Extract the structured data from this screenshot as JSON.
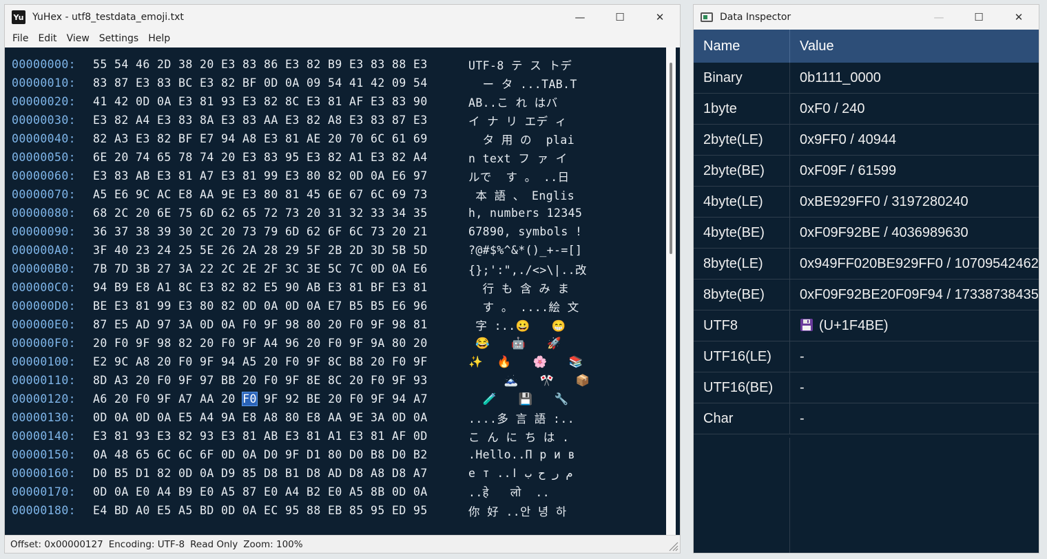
{
  "main_window": {
    "title": "YuHex - utf8_testdata_emoji.txt",
    "app_icon_text": "Yu",
    "caption": {
      "minimize": "—",
      "maximize": "☐",
      "close": "✕"
    }
  },
  "menu": [
    "File",
    "Edit",
    "View",
    "Settings",
    "Help"
  ],
  "hex_rows": [
    {
      "addr": "00000000:",
      "bytes": "55 54 46 2D 38 20 E3 83 86 E3 82 B9 E3 83 88 E3",
      "ascii": "UTF-8 テ ス トデ"
    },
    {
      "addr": "00000010:",
      "bytes": "83 87 E3 83 BC E3 82 BF 0D 0A 09 54 41 42 09 54",
      "ascii": "  ー タ ...TAB.T"
    },
    {
      "addr": "00000020:",
      "bytes": "41 42 0D 0A E3 81 93 E3 82 8C E3 81 AF E3 83 90",
      "ascii": "AB..こ れ はバ"
    },
    {
      "addr": "00000030:",
      "bytes": "E3 82 A4 E3 83 8A E3 83 AA E3 82 A8 E3 83 87 E3",
      "ascii": "イ ナ リ エデ ィ"
    },
    {
      "addr": "00000040:",
      "bytes": "82 A3 E3 82 BF E7 94 A8 E3 81 AE 20 70 6C 61 69",
      "ascii": "  タ 用 の  plai"
    },
    {
      "addr": "00000050:",
      "bytes": "6E 20 74 65 78 74 20 E3 83 95 E3 82 A1 E3 82 A4",
      "ascii": "n text フ ァ イ"
    },
    {
      "addr": "00000060:",
      "bytes": "E3 83 AB E3 81 A7 E3 81 99 E3 80 82 0D 0A E6 97",
      "ascii": "ルで  す 。 ..日"
    },
    {
      "addr": "00000070:",
      "bytes": "A5 E6 9C AC E8 AA 9E E3 80 81 45 6E 67 6C 69 73",
      "ascii": " 本 語 、 Englis"
    },
    {
      "addr": "00000080:",
      "bytes": "68 2C 20 6E 75 6D 62 65 72 73 20 31 32 33 34 35",
      "ascii": "h, numbers 12345"
    },
    {
      "addr": "00000090:",
      "bytes": "36 37 38 39 30 2C 20 73 79 6D 62 6F 6C 73 20 21",
      "ascii": "67890, symbols !"
    },
    {
      "addr": "000000A0:",
      "bytes": "3F 40 23 24 25 5E 26 2A 28 29 5F 2B 2D 3D 5B 5D",
      "ascii": "?@#$%^&*()_+-=[]"
    },
    {
      "addr": "000000B0:",
      "bytes": "7B 7D 3B 27 3A 22 2C 2E 2F 3C 3E 5C 7C 0D 0A E6",
      "ascii": "{};':\",./<>\\|..改"
    },
    {
      "addr": "000000C0:",
      "bytes": "94 B9 E8 A1 8C E3 82 82 E5 90 AB E3 81 BF E3 81",
      "ascii": "  行 も 含 み ま"
    },
    {
      "addr": "000000D0:",
      "bytes": "BE E3 81 99 E3 80 82 0D 0A 0D 0A E7 B5 B5 E6 96",
      "ascii": "  す 。 ....絵 文"
    },
    {
      "addr": "000000E0:",
      "bytes": "87 E5 AD 97 3A 0D 0A F0 9F 98 80 20 F0 9F 98 81",
      "ascii": " 字 :..😀   😁"
    },
    {
      "addr": "000000F0:",
      "bytes": "20 F0 9F 98 82 20 F0 9F A4 96 20 F0 9F 9A 80 20",
      "ascii": " 😂   🤖   🚀"
    },
    {
      "addr": "00000100:",
      "bytes": "E2 9C A8 20 F0 9F 94 A5 20 F0 9F 8C B8 20 F0 9F",
      "ascii": "✨  🔥   🌸   📚"
    },
    {
      "addr": "00000110:",
      "bytes": "8D A3 20 F0 9F 97 BB 20 F0 9F 8E 8C 20 F0 9F 93",
      "ascii": "     🗻   🎌   📦"
    },
    {
      "addr": "00000120:",
      "bytes": "A6 20 F0 9F A7 AA 20 F0 9F 92 BE 20 F0 9F 94 A7",
      "ascii": "  🧪   💾   🔧",
      "selected_index": 7
    },
    {
      "addr": "00000130:",
      "bytes": "0D 0A 0D 0A E5 A4 9A E8 A8 80 E8 AA 9E 3A 0D 0A",
      "ascii": "....多 言 語 :.."
    },
    {
      "addr": "00000140:",
      "bytes": "E3 81 93 E3 82 93 E3 81 AB E3 81 A1 E3 81 AF 0D",
      "ascii": "こ ん に ち は ."
    },
    {
      "addr": "00000150:",
      "bytes": "0A 48 65 6C 6C 6F 0D 0A D0 9F D1 80 D0 B8 D0 B2",
      "ascii": ".Hello..П р и в"
    },
    {
      "addr": "00000160:",
      "bytes": "D0 B5 D1 82 0D 0A D9 85 D8 B1 D8 AD D8 A8 D8 A7",
      "ascii": "е т ..م ر ح ب ا"
    },
    {
      "addr": "00000170:",
      "bytes": "0D 0A E0 A4 B9 E0 A5 87 E0 A4 B2 E0 A5 8B 0D 0A",
      "ascii": "..हे   लो  .."
    },
    {
      "addr": "00000180:",
      "bytes": "E4 BD A0 E5 A5 BD 0D 0A EC 95 88 EB 85 95 ED 95",
      "ascii": "你 好 ..안 녕 하"
    }
  ],
  "status": {
    "offset": "Offset: 0x00000127",
    "encoding": "Encoding: UTF-8",
    "mode": "Read Only",
    "zoom": "Zoom: 100%"
  },
  "inspector": {
    "title": "Data Inspector",
    "caption": {
      "minimize": "—",
      "maximize": "☐",
      "close": "✕"
    },
    "columns": [
      "Name",
      "Value"
    ],
    "rows": [
      {
        "name": "Binary",
        "value": "0b1111_0000"
      },
      {
        "name": "1byte",
        "value": "0xF0 / 240"
      },
      {
        "name": "2byte(LE)",
        "value": "0x9FF0 / 40944"
      },
      {
        "name": "2byte(BE)",
        "value": "0xF09F / 61599"
      },
      {
        "name": "4byte(LE)",
        "value": "0xBE929FF0 / 3197280240"
      },
      {
        "name": "4byte(BE)",
        "value": "0xF09F92BE / 4036989630"
      },
      {
        "name": "8byte(LE)",
        "value": "0x949FF020BE929FF0 / 10709542462"
      },
      {
        "name": "8byte(BE)",
        "value": "0xF09F92BE20F09F94 / 17338738435"
      },
      {
        "name": "UTF8",
        "value": "(U+1F4BE)",
        "icon": "floppy-disk-icon"
      },
      {
        "name": "UTF16(LE)",
        "value": "-"
      },
      {
        "name": "UTF16(BE)",
        "value": "-"
      },
      {
        "name": "Char",
        "value": "-"
      }
    ]
  },
  "colors": {
    "hex_background": "#0d1f30",
    "address": "#7fb6ea",
    "selection": "#2a63b8",
    "inspector_header": "#2d4e78"
  }
}
